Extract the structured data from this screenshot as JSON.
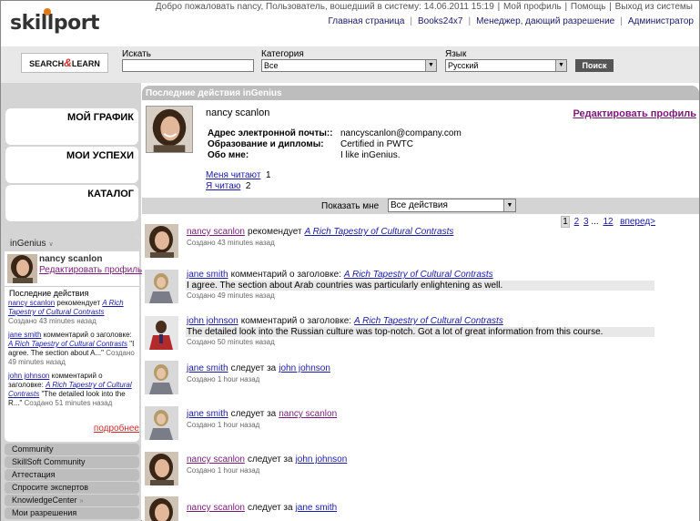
{
  "header": {
    "logo": "skillport",
    "welcome": "Добро пожаловать nancy, Пользователь, вошедший в систему: 14.06.2011 15:19",
    "welcome_links": [
      "Мой профиль",
      "Помощь",
      "Выход из системы"
    ],
    "nav": [
      "Главная страница",
      "Books24x7",
      "Менеджер, дающий разрешение",
      "Администратор"
    ]
  },
  "search": {
    "logo_left": "SEARCH",
    "logo_amp": "&",
    "logo_right": "LEARN",
    "search_label": "Искать",
    "search_value": "",
    "category_label": "Категория",
    "category_value": "Все",
    "language_label": "Язык",
    "language_value": "Русский",
    "button": "Поиск"
  },
  "sidebar": {
    "boxes": [
      "МОЙ ГРАФИК",
      "МОИ УСПЕХИ",
      "КАТАЛОГ"
    ],
    "ingenius": {
      "title": "inGenius",
      "name": "nancy scanlon",
      "edit": "Редактировать профиль",
      "subtitle": "Последние действия",
      "entries": [
        {
          "who": "nancy scanlon",
          "verb": "рекомендует",
          "what": "A Rich Tapestry of Cultural Contrasts",
          "ts": "Создано 43 minutes назад"
        },
        {
          "who": "jane smith",
          "verb": "комментарий о заголовке:",
          "what": "A Rich Tapestry of Cultural Contrasts",
          "quote": "\"I agree. The section about A...\"",
          "ts": "Создано 49 minutes назад"
        },
        {
          "who": "john johnson",
          "verb": "комментарий о заголовке:",
          "what": "A Rich Tapestry of Cultural Contrasts",
          "quote": "\"The detailed look into the R...\"",
          "ts": "Создано 51 minutes назад"
        }
      ],
      "more": "подробнее"
    },
    "menu": [
      "Community",
      "SkillSoft Community",
      "Аттестация",
      "Спросите экспертов",
      "KnowledgeCenter",
      "Мои разрешения"
    ]
  },
  "main": {
    "title": "Последние действия inGenius",
    "profile": {
      "name": "nancy  scanlon",
      "edit": "Редактировать профиль",
      "fields": [
        {
          "k": "Адрес электронной почты::",
          "v": "nancyscanlon@company.com"
        },
        {
          "k": "Образование и дипломы:",
          "v": "Certified in PWTC"
        },
        {
          "k": "Обо мне:",
          "v": "I like inGenius."
        }
      ],
      "followers_label": "Меня читают",
      "followers_count": "1",
      "following_label": "Я читаю",
      "following_count": "2"
    },
    "filter": {
      "label": "Показать мне",
      "value": "Все действия"
    },
    "pager": {
      "current": "1",
      "pages": [
        "2",
        "3"
      ],
      "ellipsis": "...",
      "last": "12",
      "next": "вперед>"
    },
    "feed": [
      {
        "who": "nancy scanlon",
        "verb": "рекомендует",
        "what": "A Rich Tapestry of Cultural Contrasts",
        "ts": "Создано 43 minutes назад"
      },
      {
        "who": "jane smith",
        "verb": "комментарий о заголовке:",
        "what": "A Rich Tapestry of Cultural Contrasts",
        "comment": "I agree. The section about Arab countries was particularly enlightening as well.",
        "ts": "Создано 49 minutes назад"
      },
      {
        "who": "john johnson",
        "verb": "комментарий о заголовке:",
        "what": "A Rich Tapestry of Cultural Contrasts",
        "comment": "The detailed look into the Russian culture was top-notch. Got a lot of great information from this course.",
        "ts": "Создано 50 minutes назад"
      },
      {
        "who": "jane smith",
        "verb": "следует за",
        "what": "john johnson",
        "ts": "Создано 1 hour назад"
      },
      {
        "who": "jane smith",
        "verb": "следует за",
        "what": "nancy scanlon",
        "ts": "Создано 1 hour назад"
      },
      {
        "who": "nancy scanlon",
        "verb": "следует за",
        "what": "john johnson",
        "ts": "Создано 1 hour назад"
      },
      {
        "who": "nancy scanlon",
        "verb": "следует за",
        "what": "jane smith",
        "ts": ""
      }
    ]
  }
}
